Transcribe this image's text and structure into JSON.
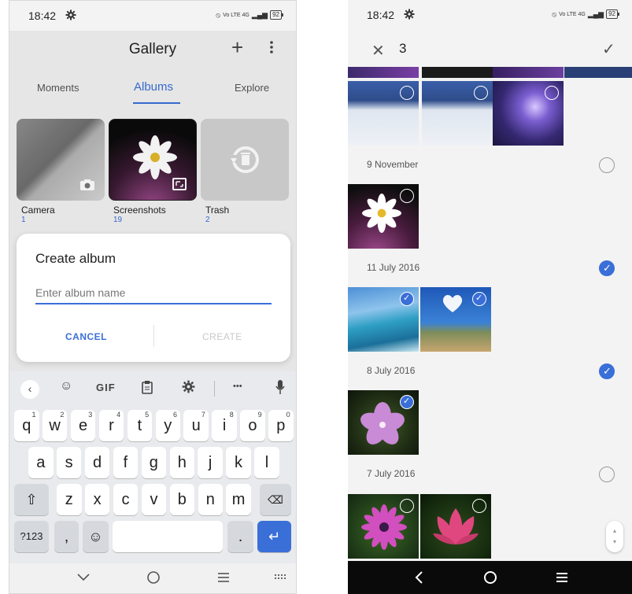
{
  "left": {
    "status": {
      "time": "18:42",
      "network": "Vo LTE 4G",
      "battery": "92"
    },
    "header": {
      "title": "Gallery",
      "add_icon": "plus-icon",
      "more_icon": "more-vert-icon"
    },
    "tabs": [
      {
        "label": "Moments",
        "active": false
      },
      {
        "label": "Albums",
        "active": true
      },
      {
        "label": "Explore",
        "active": false
      }
    ],
    "albums": [
      {
        "name": "Camera",
        "count": "1"
      },
      {
        "name": "Screenshots",
        "count": "19"
      },
      {
        "name": "Trash",
        "count": "2"
      }
    ],
    "dialog": {
      "title": "Create album",
      "placeholder": "Enter album name",
      "cancel": "CANCEL",
      "create": "CREATE"
    },
    "keyboard": {
      "toolbar": {
        "gif": "GIF",
        "dots": "•••"
      },
      "row1": [
        {
          "k": "q",
          "s": "1"
        },
        {
          "k": "w",
          "s": "2"
        },
        {
          "k": "e",
          "s": "3"
        },
        {
          "k": "r",
          "s": "4"
        },
        {
          "k": "t",
          "s": "5"
        },
        {
          "k": "y",
          "s": "6"
        },
        {
          "k": "u",
          "s": "7"
        },
        {
          "k": "i",
          "s": "8"
        },
        {
          "k": "o",
          "s": "9"
        },
        {
          "k": "p",
          "s": "0"
        }
      ],
      "row2": [
        "a",
        "s",
        "d",
        "f",
        "g",
        "h",
        "j",
        "k",
        "l"
      ],
      "row3": [
        "z",
        "x",
        "c",
        "v",
        "b",
        "n",
        "m"
      ],
      "row4": {
        "sym": "?123",
        "comma": ",",
        "period": "."
      }
    }
  },
  "right": {
    "status": {
      "time": "18:42",
      "network": "Vo LTE 4G",
      "battery": "92"
    },
    "selection": {
      "count": "3"
    },
    "sections": [
      {
        "date": "9 November",
        "checked": false
      },
      {
        "date": "11 July 2016",
        "checked": true
      },
      {
        "date": "8 July 2016",
        "checked": true
      },
      {
        "date": "7 July 2016",
        "checked": false
      }
    ],
    "colors": {
      "accent": "#3a6fd8"
    }
  }
}
